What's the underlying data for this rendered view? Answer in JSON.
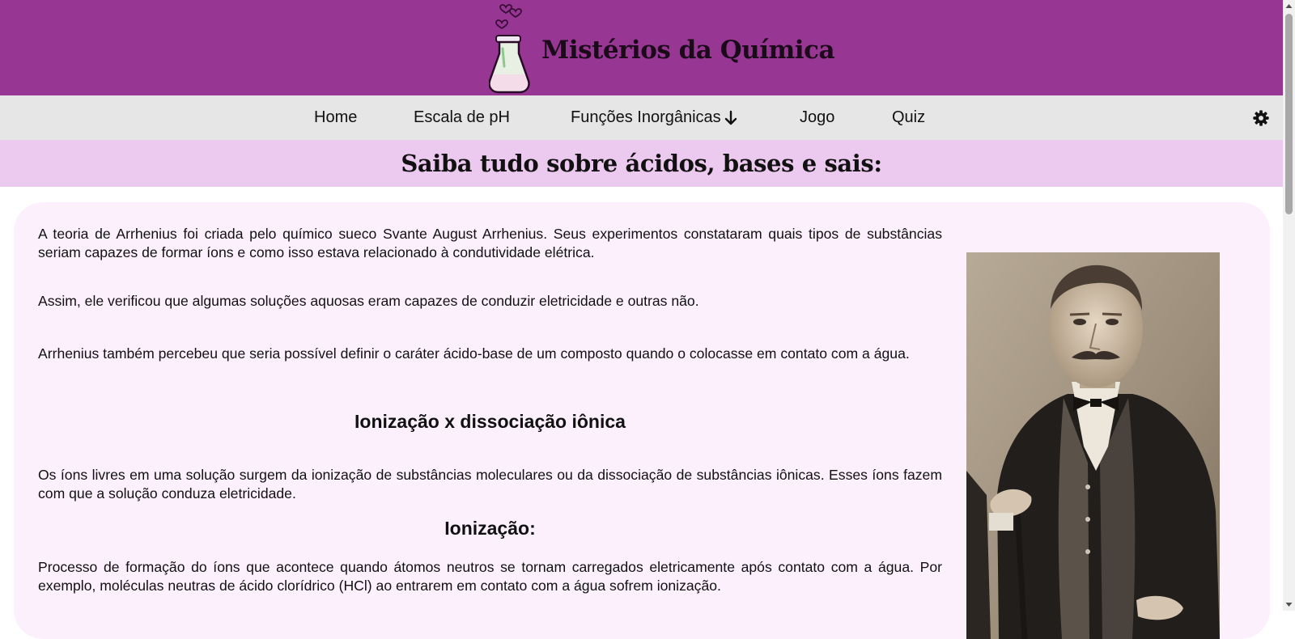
{
  "header": {
    "logo_text": "Mistérios da Química",
    "logo_icon": "flask-with-hearts-icon",
    "background_color": "#983793"
  },
  "nav": {
    "items": [
      {
        "label": "Home"
      },
      {
        "label": "Escala de pH"
      },
      {
        "label": "Funções Inorgânicas",
        "icon": "arrow-down-icon"
      },
      {
        "label": "Jogo"
      },
      {
        "label": "Quiz"
      }
    ],
    "settings_icon": "gear-icon",
    "background_color": "#e6e6e6"
  },
  "title_bar": {
    "title": "Saiba tudo sobre ácidos, bases e sais:",
    "background_color": "#ecc9ee"
  },
  "content": {
    "paragraphs": [
      "A teoria de Arrhenius foi criada pelo químico sueco Svante August Arrhenius. Seus experimentos constataram quais tipos de substâncias seriam capazes de formar íons e como isso estava relacionado à condutividade elétrica.",
      "Assim, ele verificou que algumas soluções aquosas eram capazes de conduzir eletricidade e outras não.",
      "Arrhenius também percebeu que seria possível definir o caráter ácido-base de um composto quando o colocasse em contato com a água."
    ],
    "section_heading": "Ionização x dissociação iônica",
    "section_paragraph": "Os íons livres em uma solução surgem da ionização de substâncias moleculares ou da dissociação de substâncias iônicas. Esses íons fazem com que a solução conduza eletricidade.",
    "subheading": "Ionização:",
    "subheading_paragraph": "Processo de formação do íons que acontece quando átomos neutros se tornam carregados eletricamente após contato com a água. Por exemplo, moléculas neutras de ácido clorídrico (HCl) ao entrarem em contato com a água sofrem ionização.",
    "portrait_icon": "arrhenius-portrait-photo",
    "background_color": "#fcf0fd"
  }
}
